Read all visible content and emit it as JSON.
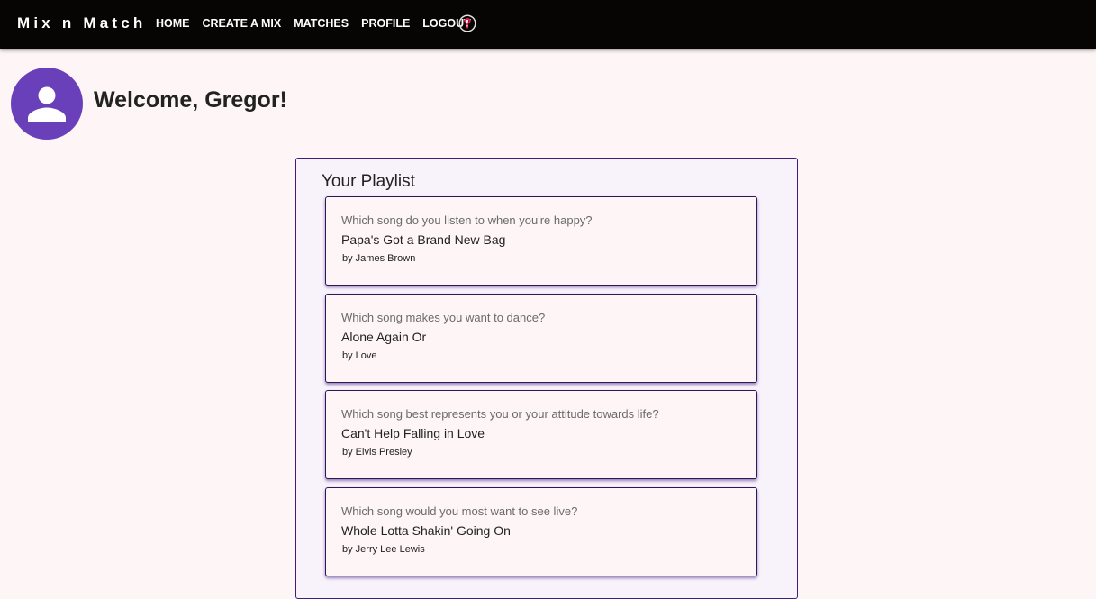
{
  "nav": {
    "brand": "Mix n Match",
    "links": [
      "HOME",
      "CREATE A MIX",
      "MATCHES",
      "PROFILE",
      "LOGOUT"
    ],
    "help_icon": "help-circle-icon"
  },
  "profile": {
    "avatar_icon": "person-icon",
    "welcome": "Welcome, Gregor!"
  },
  "playlist": {
    "title": "Your Playlist",
    "songs": [
      {
        "question": "Which song do you listen to when you're happy?",
        "title": "Papa's Got a Brand New Bag",
        "artist": "by James Brown"
      },
      {
        "question": "Which song makes you want to dance?",
        "title": "Alone Again Or",
        "artist": "by Love"
      },
      {
        "question": "Which song best represents you or your attitude towards life?",
        "title": "Can't Help Falling in Love",
        "artist": "by Elvis Presley"
      },
      {
        "question": "Which song would you most want to see live?",
        "title": "Whole Lotta Shakin' Going On",
        "artist": "by Jerry Lee Lewis"
      }
    ]
  },
  "colors": {
    "navbar_bg": "#070504",
    "accent": "#6a3fba",
    "page_bg": "#fdf5f6",
    "help_icon": "#e8174f"
  }
}
